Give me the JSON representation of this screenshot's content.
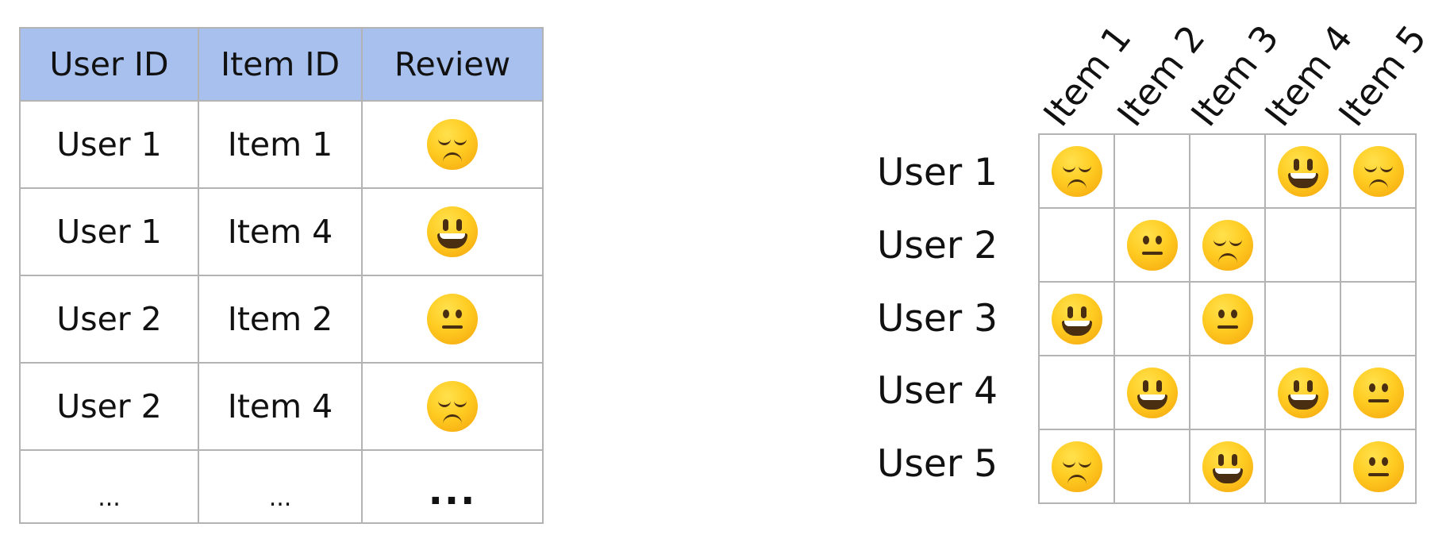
{
  "table": {
    "headers": [
      "User ID",
      "Item ID",
      "Review"
    ],
    "rows": [
      {
        "user": "User 1",
        "item": "Item 1",
        "review": "sad"
      },
      {
        "user": "User 1",
        "item": "Item 4",
        "review": "happy"
      },
      {
        "user": "User 2",
        "item": "Item 2",
        "review": "neutral"
      },
      {
        "user": "User 2",
        "item": "Item 4",
        "review": "sad"
      }
    ],
    "ellipsis_row": [
      "...",
      "...",
      "..."
    ],
    "header_color": "#a8c0ee"
  },
  "matrix": {
    "columns": [
      "Item 1",
      "Item 2",
      "Item 3",
      "Item 4",
      "Item 5"
    ],
    "rows": [
      "User 1",
      "User 2",
      "User 3",
      "User 4",
      "User 5"
    ],
    "cells": [
      [
        "sad",
        "",
        "",
        "happy",
        "sad"
      ],
      [
        "",
        "neutral",
        "sad",
        "",
        ""
      ],
      [
        "happy",
        "",
        "neutral",
        "",
        ""
      ],
      [
        "",
        "happy",
        "",
        "happy",
        "neutral"
      ],
      [
        "sad",
        "",
        "happy",
        "",
        "neutral"
      ]
    ]
  },
  "icons": {
    "happy": "grinning-face-icon",
    "neutral": "neutral-face-icon",
    "sad": "disappointed-face-icon"
  }
}
